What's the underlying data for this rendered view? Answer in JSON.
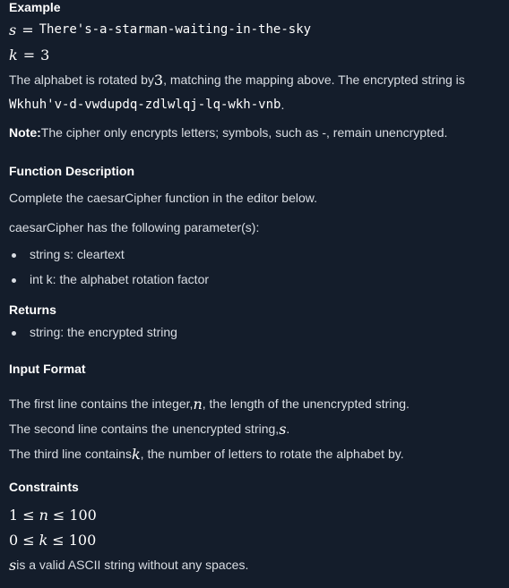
{
  "example": {
    "heading": "Example",
    "s_lhs": "s",
    "s_eq": "=",
    "s_value": "There's-a-starman-waiting-in-the-sky",
    "k_lhs": "k",
    "k_eq": "=",
    "k_value": "3",
    "para1_a": "The alphabet is rotated by ",
    "para1_k": "3",
    "para1_b": ", matching the mapping above. The encrypted string is",
    "encrypted": "Wkhuh'v-d-vwdupdq-zdlwlqj-lq-wkh-vnb",
    "encrypted_end": ".",
    "note_label": "Note:",
    "note_text": " The cipher only encrypts letters; symbols, such as -, remain unencrypted."
  },
  "function_description": {
    "heading": "Function Description",
    "line1": "Complete the caesarCipher function in the editor below.",
    "line2": "caesarCipher has the following parameter(s):",
    "params": [
      "string s: cleartext",
      "int k: the alphabet rotation factor"
    ]
  },
  "returns": {
    "heading": "Returns",
    "items": [
      "string: the encrypted string"
    ]
  },
  "input_format": {
    "heading": "Input Format",
    "line1_a": "The first line contains the integer, ",
    "line1_var": "n",
    "line1_b": ", the length of the unencrypted string.",
    "line2_a": "The second line contains the unencrypted string, ",
    "line2_var": "s",
    "line2_b": ".",
    "line3_a": "The third line contains ",
    "line3_var": "k",
    "line3_b": ", the number of letters to rotate the alphabet by."
  },
  "constraints": {
    "heading": "Constraints",
    "c1_lo": "1",
    "c1_le1": "≤",
    "c1_var": "n",
    "c1_le2": "≤",
    "c1_hi": "100",
    "c2_lo": "0",
    "c2_le1": "≤",
    "c2_var": "k",
    "c2_le2": "≤",
    "c2_hi": "100",
    "c3_var": "s",
    "c3_text": " is a valid ASCII string without any spaces."
  }
}
